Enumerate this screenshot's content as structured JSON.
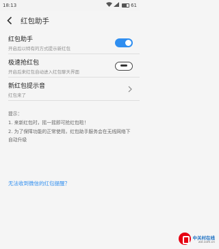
{
  "status_bar": {
    "time": "18:13",
    "battery": "61",
    "battery_level": 0.61
  },
  "header": {
    "title": "红包助手"
  },
  "settings": [
    {
      "title": "红包助手",
      "subtitle": "开启后以特有的方式提示新红包",
      "control": "toggle",
      "state": "on"
    },
    {
      "title": "极速抢红包",
      "subtitle": "开启后来红包自动进入红包聊天界面",
      "control": "toggle",
      "state": "off"
    },
    {
      "title": "新红包提示音",
      "subtitle": "红包来了",
      "control": "chevron"
    }
  ],
  "tips": {
    "heading": "提示：",
    "items": [
      "1. 来新红包时，摇一摇即可抢红包啦！",
      "2. 为了保障功能的正常使用，红包助手服务会在无线网络下自动升级"
    ]
  },
  "help_link": "无法收到微信的红包提醒？",
  "watermark": {
    "name": "中关村在线",
    "url": "zol.com.cn"
  },
  "colors": {
    "accent": "#2f8ef0",
    "background": "#f5f5f5"
  }
}
